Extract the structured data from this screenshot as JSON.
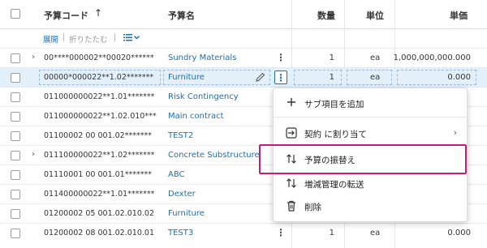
{
  "header": {
    "code_label": "予算コード",
    "sort_icon": "arrow-up-icon",
    "name_label": "予算名",
    "qty_label": "数量",
    "unit_label": "単位",
    "price_label": "単価"
  },
  "toolbar": {
    "expand": "展開",
    "collapse": "折りたたむ",
    "separator": "|"
  },
  "rows": [
    {
      "code": "00****000002**00020******",
      "name": "Sundry Materials",
      "qty": "1",
      "unit": "ea",
      "price": "1,000,000,000.000",
      "expand": true
    },
    {
      "code": "00000*000022**1.02*******",
      "name": "Furniture",
      "qty": "1",
      "unit": "ea",
      "price": "0.000",
      "selected": true
    },
    {
      "code": "011000000022**1.01*******",
      "name": "Risk Contingency"
    },
    {
      "code": "011000000022**1.02.010***",
      "name": "Main contract"
    },
    {
      "code": "01100002 00 001.02*******",
      "name": "TEST2"
    },
    {
      "code": "011100000022**1.02*******",
      "name": "Concrete Substructure",
      "expand": true
    },
    {
      "code": "01110001 00 001.01*******",
      "name": "ABC"
    },
    {
      "code": "011400000022**1.01*******",
      "name": "Dexter"
    },
    {
      "code": "01200002 05 001.02.010.02",
      "name": "Furniture"
    },
    {
      "code": "01200002 08 001.02.010.01",
      "name": "TEST3",
      "qty": "1",
      "unit": "ea",
      "price": "0.000"
    }
  ],
  "menu": {
    "items": [
      {
        "icon": "plus-icon",
        "label": "サブ項目を追加"
      },
      {
        "icon": "assign-icon",
        "label": "契約 に割り当て",
        "chevron": true
      },
      {
        "icon": "transfer-icon",
        "label": "予算の振替え"
      },
      {
        "icon": "transfer-icon",
        "label": "増減管理の転送"
      },
      {
        "icon": "trash-icon",
        "label": "削除"
      }
    ]
  },
  "colors": {
    "link": "#1b6fb5",
    "highlight": "#c81c74",
    "selected_row": "#e3f0fa"
  }
}
